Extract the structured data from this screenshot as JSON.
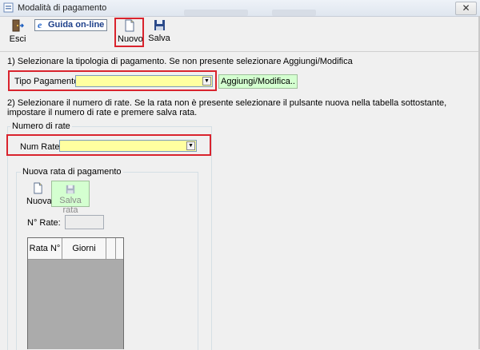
{
  "window": {
    "title": "Modalità di pagamento",
    "close_glyph": "✕"
  },
  "toolbar": {
    "esci_label": "Esci",
    "guida_label": "Guida on-line",
    "guida_icon_glyph": "e",
    "nuovo_label": "Nuovo",
    "salva_label": "Salva"
  },
  "step1": {
    "instruction": "1) Selezionare la tipologia di pagamento. Se non presente selezionare Aggiungi/Modifica",
    "tipo_label": "Tipo Pagamento:",
    "tipo_value": "",
    "aggiungi_label": "Aggiungi/Modifica.."
  },
  "step2": {
    "instruction_line1": "2) Selezionare il numero di rate. Se la rata non è presente selezionare il pulsante nuova nella tabella sottostante,",
    "instruction_line2": "impostare il numero di rate e premere salva rata."
  },
  "numero_rate": {
    "legend": "Numero di rate",
    "num_label": "Num Rate:",
    "num_value": ""
  },
  "nuova_rata": {
    "legend": "Nuova rata di pagamento",
    "nuova_label": "Nuova",
    "salva_rata_label": "Salva rata",
    "n_rate_label": "N° Rate:",
    "n_rate_value": ""
  },
  "table": {
    "columns": [
      "Rata N°",
      "Giorni"
    ]
  },
  "colors": {
    "highlight": "#d9232d",
    "combo_bg": "#ffffa0",
    "green_button": "#d4ffd0"
  }
}
